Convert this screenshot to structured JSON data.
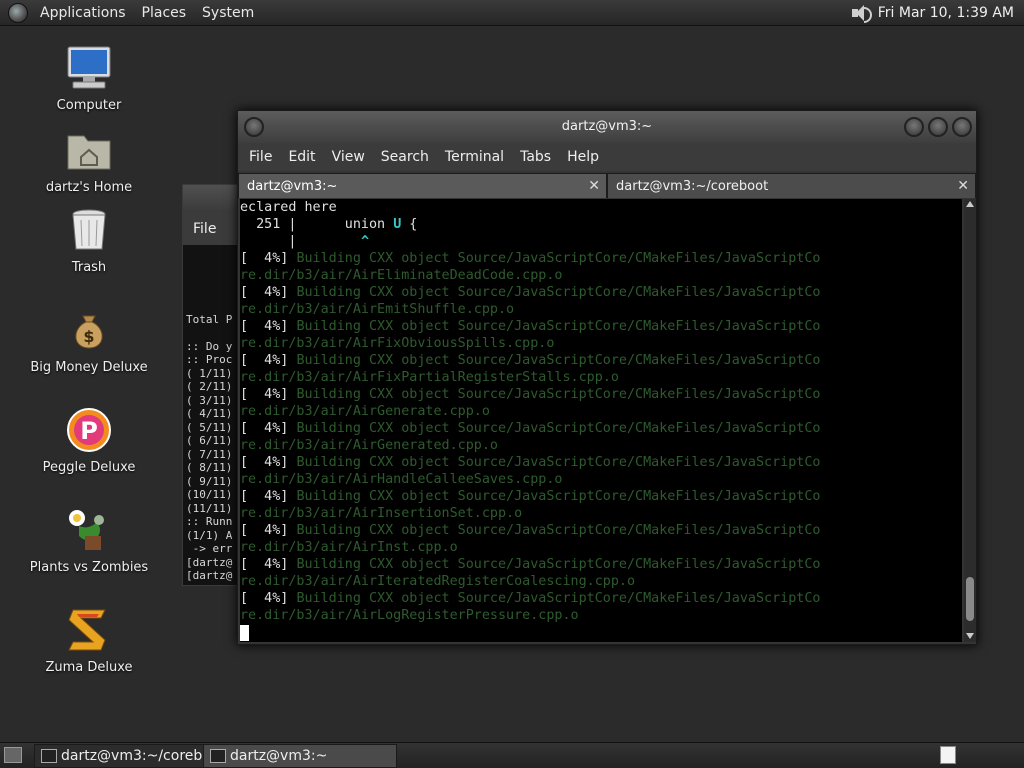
{
  "top_panel": {
    "menus": [
      "Applications",
      "Places",
      "System"
    ],
    "clock": "Fri Mar 10,  1:39 AM"
  },
  "desktop_icons": [
    {
      "label": "Computer",
      "icon": "computer-icon"
    },
    {
      "label": "dartz's Home",
      "icon": "home-folder-icon"
    },
    {
      "label": "Trash",
      "icon": "trash-icon"
    },
    {
      "label": "Big Money Deluxe",
      "icon": "money-bag-icon"
    },
    {
      "label": "Peggle Deluxe",
      "icon": "peggle-icon"
    },
    {
      "label": "Plants vs Zombies",
      "icon": "plants-vs-zombies-icon"
    },
    {
      "label": "Zuma Deluxe",
      "icon": "zuma-icon"
    }
  ],
  "back_window": {
    "menu_label": "File",
    "lines": [
      "",
      "Total P",
      "",
      ":: Do y",
      ":: Proc",
      "( 1/11)",
      "( 2/11)",
      "( 3/11)",
      "( 4/11)",
      "( 5/11)",
      "( 6/11)",
      "( 7/11)",
      "( 8/11)",
      "( 9/11)",
      "(10/11)",
      "(11/11)",
      ":: Runn",
      "(1/1) A",
      " -> err",
      "[dartz@",
      "[dartz@"
    ]
  },
  "terminal": {
    "title": "dartz@vm3:~",
    "menus": [
      "File",
      "Edit",
      "View",
      "Search",
      "Terminal",
      "Tabs",
      "Help"
    ],
    "tabs": [
      {
        "label": "dartz@vm3:~",
        "active": true
      },
      {
        "label": "dartz@vm3:~/coreboot",
        "active": false
      }
    ],
    "head": {
      "line1": "eclared here",
      "line2_prefix": "  251 |      union ",
      "line2_highlight": "U",
      "line2_suffix": " {",
      "line3_prefix": "      |        ",
      "line3_caret": "^"
    },
    "build_entries": [
      {
        "prefix": "[  4%] ",
        "line1": "Building CXX object Source/JavaScriptCore/CMakeFiles/JavaScriptCo",
        "line2": "re.dir/b3/air/AirEliminateDeadCode.cpp.o"
      },
      {
        "prefix": "[  4%] ",
        "line1": "Building CXX object Source/JavaScriptCore/CMakeFiles/JavaScriptCo",
        "line2": "re.dir/b3/air/AirEmitShuffle.cpp.o"
      },
      {
        "prefix": "[  4%] ",
        "line1": "Building CXX object Source/JavaScriptCore/CMakeFiles/JavaScriptCo",
        "line2": "re.dir/b3/air/AirFixObviousSpills.cpp.o"
      },
      {
        "prefix": "[  4%] ",
        "line1": "Building CXX object Source/JavaScriptCore/CMakeFiles/JavaScriptCo",
        "line2": "re.dir/b3/air/AirFixPartialRegisterStalls.cpp.o"
      },
      {
        "prefix": "[  4%] ",
        "line1": "Building CXX object Source/JavaScriptCore/CMakeFiles/JavaScriptCo",
        "line2": "re.dir/b3/air/AirGenerate.cpp.o"
      },
      {
        "prefix": "[  4%] ",
        "line1": "Building CXX object Source/JavaScriptCore/CMakeFiles/JavaScriptCo",
        "line2": "re.dir/b3/air/AirGenerated.cpp.o"
      },
      {
        "prefix": "[  4%] ",
        "line1": "Building CXX object Source/JavaScriptCore/CMakeFiles/JavaScriptCo",
        "line2": "re.dir/b3/air/AirHandleCalleeSaves.cpp.o"
      },
      {
        "prefix": "[  4%] ",
        "line1": "Building CXX object Source/JavaScriptCore/CMakeFiles/JavaScriptCo",
        "line2": "re.dir/b3/air/AirInsertionSet.cpp.o"
      },
      {
        "prefix": "[  4%] ",
        "line1": "Building CXX object Source/JavaScriptCore/CMakeFiles/JavaScriptCo",
        "line2": "re.dir/b3/air/AirInst.cpp.o"
      },
      {
        "prefix": "[  4%] ",
        "line1": "Building CXX object Source/JavaScriptCore/CMakeFiles/JavaScriptCo",
        "line2": "re.dir/b3/air/AirIteratedRegisterCoalescing.cpp.o"
      },
      {
        "prefix": "[  4%] ",
        "line1": "Building CXX object Source/JavaScriptCore/CMakeFiles/JavaScriptCo",
        "line2": "re.dir/b3/air/AirLogRegisterPressure.cpp.o"
      }
    ],
    "colors": {
      "background": "#000000",
      "text": "#e0e0e0",
      "build_text": "#2e5b2e",
      "highlight": "#38c8c8"
    }
  },
  "taskbar": {
    "tasks": [
      {
        "label": "dartz@vm3:~/coreb..."
      },
      {
        "label": "dartz@vm3:~"
      }
    ]
  }
}
